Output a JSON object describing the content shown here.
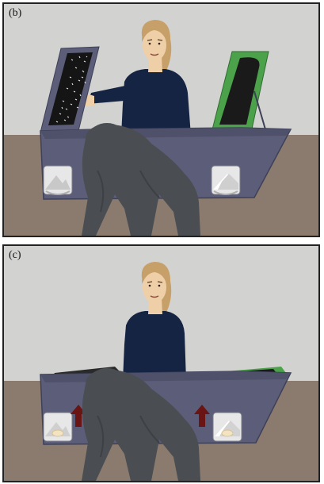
{
  "panels": [
    {
      "label": "(b)"
    },
    {
      "label": "(c)"
    }
  ],
  "colors": {
    "wall": "#d2d3d0",
    "floor": "#8b7b6f",
    "box": "#5c5e79",
    "box_edge": "#3e4058",
    "screen_green": "#4ba24a",
    "screen_black": "#1a1a1a",
    "shirt": "#162443",
    "skin": "#efcfa8",
    "hair": "#c79f69",
    "observer": "#4a4d51",
    "arrow": "#6a1414"
  }
}
